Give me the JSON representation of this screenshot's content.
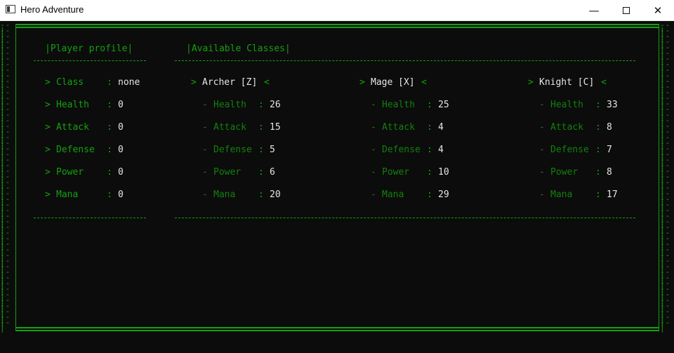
{
  "window": {
    "title": "Hero Adventure",
    "min_glyph": "—",
    "close_glyph": "✕"
  },
  "profile": {
    "header": "|Player profile|",
    "rows": [
      {
        "bullet": ">",
        "label": "Class",
        "sep": ":",
        "value": "none"
      },
      {
        "bullet": ">",
        "label": "Health",
        "sep": ":",
        "value": "0"
      },
      {
        "bullet": ">",
        "label": "Attack",
        "sep": ":",
        "value": "0"
      },
      {
        "bullet": ">",
        "label": "Defense",
        "sep": ":",
        "value": "0"
      },
      {
        "bullet": ">",
        "label": "Power",
        "sep": ":",
        "value": "0"
      },
      {
        "bullet": ">",
        "label": "Mana",
        "sep": ":",
        "value": "0"
      }
    ]
  },
  "classes_header": "|Available Classes|",
  "classes": [
    {
      "open": ">",
      "name": "Archer [Z]",
      "close": "<",
      "stats": [
        {
          "bullet": "-",
          "label": "Health",
          "sep": ":",
          "value": "26"
        },
        {
          "bullet": "-",
          "label": "Attack",
          "sep": ":",
          "value": "15"
        },
        {
          "bullet": "-",
          "label": "Defense",
          "sep": ":",
          "value": "5"
        },
        {
          "bullet": "-",
          "label": "Power",
          "sep": ":",
          "value": "6"
        },
        {
          "bullet": "-",
          "label": "Mana",
          "sep": ":",
          "value": "20"
        }
      ]
    },
    {
      "open": ">",
      "name": "Mage [X]",
      "close": "<",
      "stats": [
        {
          "bullet": "-",
          "label": "Health",
          "sep": ":",
          "value": "25"
        },
        {
          "bullet": "-",
          "label": "Attack",
          "sep": ":",
          "value": "4"
        },
        {
          "bullet": "-",
          "label": "Defense",
          "sep": ":",
          "value": "4"
        },
        {
          "bullet": "-",
          "label": "Power",
          "sep": ":",
          "value": "10"
        },
        {
          "bullet": "-",
          "label": "Mana",
          "sep": ":",
          "value": "29"
        }
      ]
    },
    {
      "open": ">",
      "name": "Knight [C]",
      "close": "<",
      "stats": [
        {
          "bullet": "-",
          "label": "Health",
          "sep": ":",
          "value": "33"
        },
        {
          "bullet": "-",
          "label": "Attack",
          "sep": ":",
          "value": "8"
        },
        {
          "bullet": "-",
          "label": "Defense",
          "sep": ":",
          "value": "7"
        },
        {
          "bullet": "-",
          "label": "Power",
          "sep": ":",
          "value": "8"
        },
        {
          "bullet": "-",
          "label": "Mana",
          "sep": ":",
          "value": "17"
        }
      ]
    }
  ],
  "border_glyph": "--|",
  "colors": {
    "accent": "#13a10e",
    "value": "#e6e6e6",
    "background": "#0c0c0c"
  }
}
